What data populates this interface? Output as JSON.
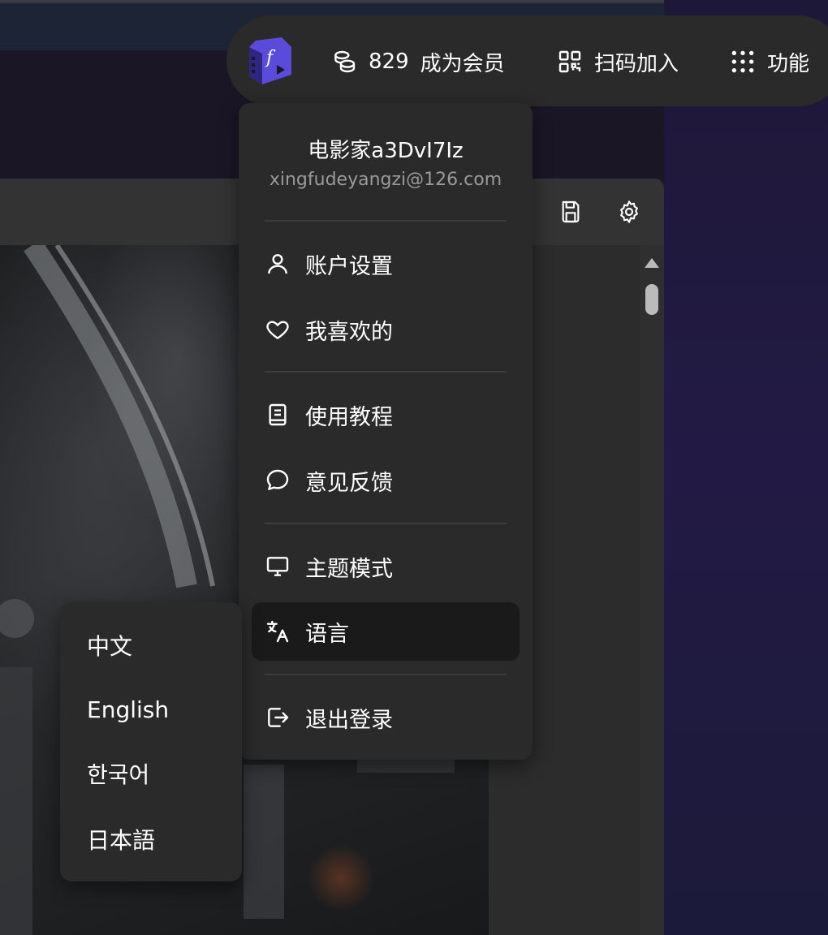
{
  "header": {
    "coins": "829",
    "member_label": "成为会员",
    "scan_label": "扫码加入",
    "features_label": "功能"
  },
  "user_menu": {
    "username": "电影家a3DvI7Iz",
    "email": "xingfudeyangzi@126.com",
    "items": [
      {
        "label": "账户设置",
        "icon": "user-icon"
      },
      {
        "label": "我喜欢的",
        "icon": "heart-icon"
      },
      {
        "label": "使用教程",
        "icon": "book-icon"
      },
      {
        "label": "意见反馈",
        "icon": "chat-bubble-icon"
      },
      {
        "label": "主题模式",
        "icon": "monitor-icon"
      },
      {
        "label": "语言",
        "icon": "translate-icon",
        "active": true
      },
      {
        "label": "退出登录",
        "icon": "logout-icon"
      }
    ]
  },
  "language_menu": {
    "items": [
      {
        "label": "中文"
      },
      {
        "label": "English"
      },
      {
        "label": "한국어"
      },
      {
        "label": "日本語"
      }
    ]
  },
  "colors": {
    "accent": "#5b4bdb",
    "menu_bg": "#2a2a2a",
    "active_bg": "#1a1a1a"
  }
}
